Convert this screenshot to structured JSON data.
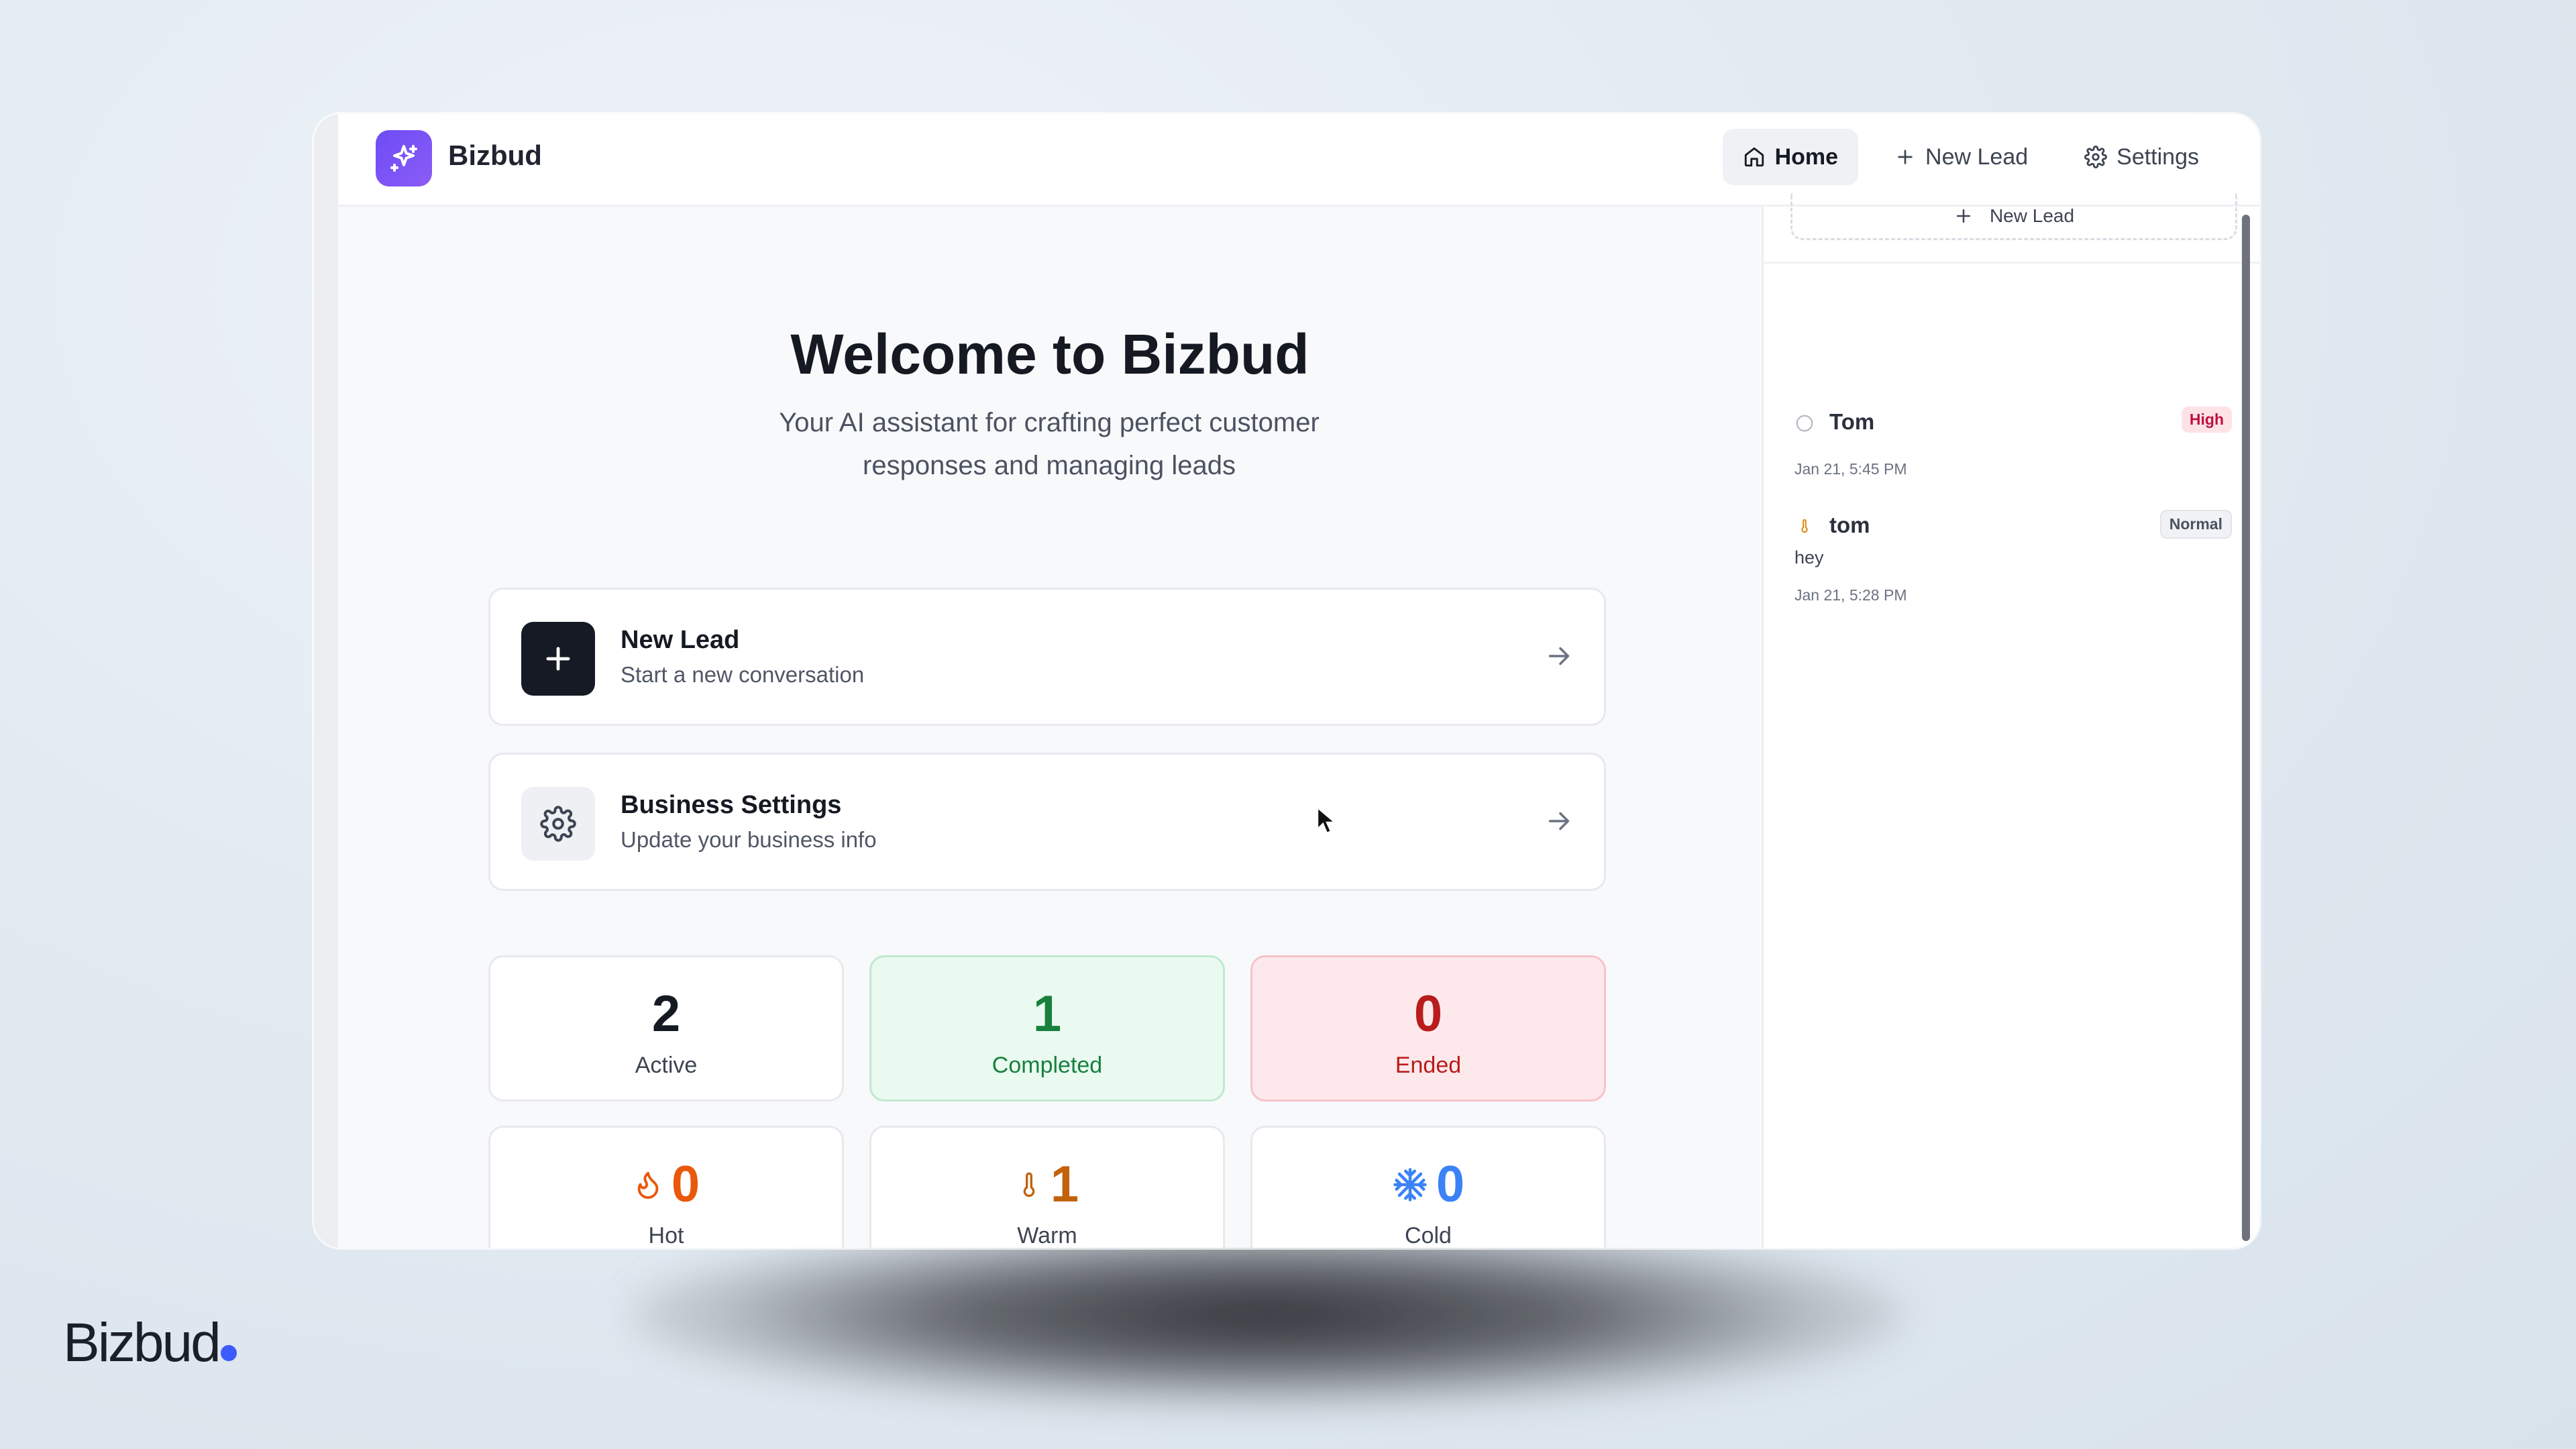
{
  "app": {
    "name": "Bizbud"
  },
  "nav": {
    "home": "Home",
    "new_lead": "New Lead",
    "settings": "Settings"
  },
  "hero": {
    "title": "Welcome to Bizbud",
    "subtitle": "Your AI assistant for crafting perfect customer responses and managing leads"
  },
  "actions": [
    {
      "title": "New Lead",
      "subtitle": "Start a new conversation",
      "icon": "plus-icon"
    },
    {
      "title": "Business Settings",
      "subtitle": "Update your business info",
      "icon": "gear-icon"
    }
  ],
  "stats": {
    "active": {
      "value": "2",
      "label": "Active"
    },
    "completed": {
      "value": "1",
      "label": "Completed"
    },
    "ended": {
      "value": "0",
      "label": "Ended"
    },
    "hot": {
      "value": "0",
      "label": "Hot",
      "icon": "flame-icon"
    },
    "warm": {
      "value": "1",
      "label": "Warm",
      "icon": "thermometer-icon"
    },
    "cold": {
      "value": "0",
      "label": "Cold",
      "icon": "snowflake-icon"
    }
  },
  "sidebar": {
    "new_lead_label": "New Lead",
    "leads": [
      {
        "name": "Tom",
        "badge": "High",
        "preview": "",
        "time": "Jan 21, 5:45 PM"
      },
      {
        "name": "tom",
        "badge": "Normal",
        "preview": "hey",
        "time": "Jan 21, 5:28 PM"
      }
    ]
  },
  "watermark": {
    "text": "Bizbud"
  },
  "colors": {
    "brand": "#7c4dff",
    "completed_bg": "#eafaf1",
    "completed_text": "#17803d",
    "ended_bg": "#fde9ec",
    "ended_text": "#b91c1c",
    "hot": "#ea580c",
    "warm": "#c2620c",
    "cold": "#3b82f6",
    "high_badge_bg": "#fde3e7",
    "high_badge_text": "#be123c"
  }
}
